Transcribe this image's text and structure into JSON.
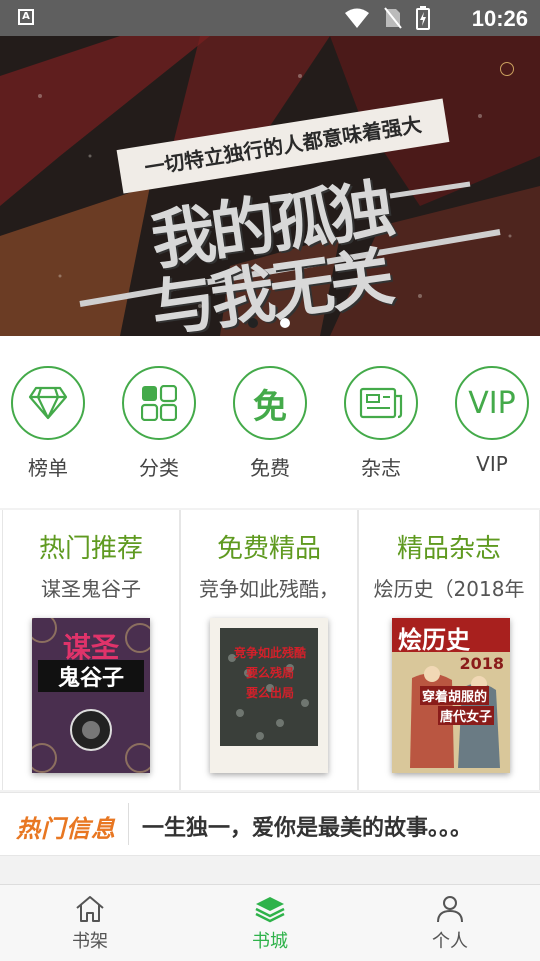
{
  "status_bar": {
    "time": "10:26",
    "notification_icon": "a-icon"
  },
  "banner": {
    "tagline": "一切特立独行的人都意味着强大",
    "title_line1": "我的孤独",
    "title_line2": "与我无关",
    "dots": 2,
    "active_dot": 0
  },
  "quick_menu": [
    {
      "label": "榜单",
      "icon": "diamond-icon"
    },
    {
      "label": "分类",
      "icon": "grid-icon"
    },
    {
      "label": "免费",
      "icon": "free-icon",
      "glyph": "免"
    },
    {
      "label": "杂志",
      "icon": "magazine-icon"
    },
    {
      "label": "VIP",
      "icon": "vip-icon",
      "glyph": "VIP"
    }
  ],
  "cards": [
    {
      "title": "热门推荐",
      "subtitle": "谋圣鬼谷子",
      "cover_text": [
        "谋圣",
        "鬼谷子"
      ]
    },
    {
      "title": "免费精品",
      "subtitle": "竞争如此残酷，",
      "cover_text": [
        "竞争如此残酷",
        "要么残局",
        "要么出局"
      ]
    },
    {
      "title": "精品杂志",
      "subtitle": "烩历史（2018年",
      "cover_text": [
        "烩历史",
        "2018",
        "穿着胡服的",
        "唐代女子"
      ]
    }
  ],
  "hot_info": {
    "logo": "热门信息",
    "text": "一生独一，爱你是最美的故事。。。"
  },
  "tab_bar": [
    {
      "label": "书架",
      "icon": "home-icon",
      "active": false
    },
    {
      "label": "书城",
      "icon": "layers-icon",
      "active": true
    },
    {
      "label": "个人",
      "icon": "person-icon",
      "active": false
    }
  ],
  "colors": {
    "accent_green": "#44aa4a",
    "card_title": "#5f9a20",
    "hot_orange": "#e87722",
    "tab_active": "#2eb24a"
  }
}
